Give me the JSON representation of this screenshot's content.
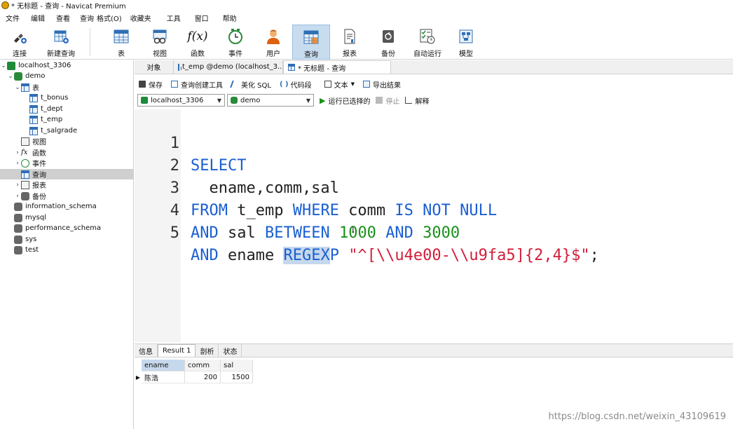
{
  "window": {
    "title": "* 无标题 - 查询 - Navicat Premium"
  },
  "menu": [
    "文件",
    "编辑",
    "查看",
    "查询",
    "格式(O)",
    "收藏夹",
    "工具",
    "窗口",
    "帮助"
  ],
  "toolbar": {
    "connect": "连接",
    "new_query": "新建查询",
    "table": "表",
    "view": "视图",
    "function": "函数",
    "event": "事件",
    "user": "用户",
    "query": "查询",
    "report": "报表",
    "backup": "备份",
    "auto_run": "自动运行",
    "model": "模型"
  },
  "sidebar": {
    "connection": "localhost_3306",
    "db_demo": "demo",
    "tables_label": "表",
    "tables": [
      "t_bonus",
      "t_dept",
      "t_emp",
      "t_salgrade"
    ],
    "views": "视图",
    "functions": "函数",
    "events": "事件",
    "queries": "查询",
    "reports": "报表",
    "backups": "备份",
    "other_dbs": [
      "information_schema",
      "mysql",
      "performance_schema",
      "sys",
      "test"
    ]
  },
  "tabs": {
    "objects": "对象",
    "temp": "t_emp @demo (localhost_3...",
    "query": "* 无标题 - 查询"
  },
  "editor_toolbar": {
    "save": "保存",
    "builder": "查询创建工具",
    "beautify": "美化 SQL",
    "snippet": "代码段",
    "text": "文本",
    "export": "导出结果"
  },
  "selectors": {
    "connection": "localhost_3306",
    "database": "demo",
    "run_selected": "运行已选择的",
    "stop": "停止",
    "explain": "解释"
  },
  "code": {
    "line_numbers": [
      "1",
      "2",
      "3",
      "4",
      "5"
    ],
    "l1": {
      "kw": "SELECT"
    },
    "l2": {
      "text": "  ename,comm,sal"
    },
    "l3": {
      "kw1": "FROM",
      "t1": " t_emp ",
      "kw2": "WHERE",
      "t2": " comm ",
      "kw3": "IS NOT NULL"
    },
    "l4": {
      "kw1": "AND",
      "t1": " sal ",
      "kw2": "BETWEEN",
      "n1": " 1000 ",
      "kw3": "AND",
      "n2": " 3000"
    },
    "l5": {
      "kw1": "AND",
      "t1": " ename ",
      "hl": "REGEX",
      "kw2": "P",
      "sp": " ",
      "str": "\"^[\\\\u4e00-\\\\u9fa5]{2,4}$\"",
      "end": ";"
    }
  },
  "result": {
    "tabs": [
      "信息",
      "Result 1",
      "剖析",
      "状态"
    ],
    "columns": [
      "ename",
      "comm",
      "sal"
    ],
    "rows": [
      [
        "陈浩",
        "200",
        "1500"
      ]
    ]
  },
  "watermark": "https://blog.csdn.net/weixin_43109619",
  "colors": {
    "keyword": "#1a5fd1",
    "number": "#1a8f1a",
    "string": "#d21d3a",
    "selection": "#c6d8ec"
  }
}
